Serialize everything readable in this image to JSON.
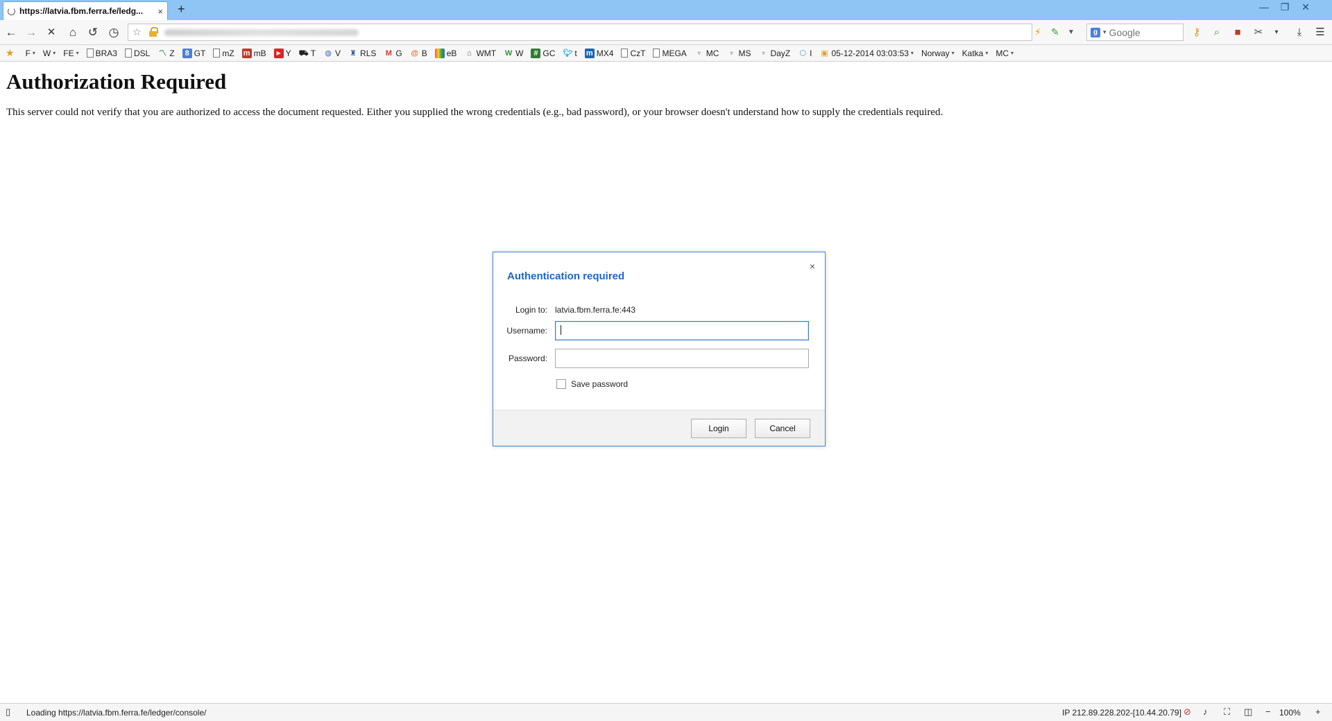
{
  "tab": {
    "title": "https://latvia.fbm.ferra.fe/ledg...",
    "close": "×",
    "new": "+"
  },
  "window": {
    "minimize": "—",
    "restore": "❐",
    "close": "✕"
  },
  "nav": {
    "back": "←",
    "forward": "→",
    "stop": "✕",
    "home": "⌂",
    "reload": "↺",
    "history": "◷"
  },
  "address": {
    "star": "☆"
  },
  "search": {
    "placeholder": "Google",
    "engine": "g"
  },
  "bookmarks": [
    {
      "label": "F",
      "dropdown": true
    },
    {
      "label": "W",
      "dropdown": true
    },
    {
      "label": "FE",
      "dropdown": true
    },
    {
      "label": "BRA3"
    },
    {
      "label": "DSL"
    },
    {
      "label": "Z"
    },
    {
      "label": "GT"
    },
    {
      "label": "mZ"
    },
    {
      "label": "mB"
    },
    {
      "label": "Y"
    },
    {
      "label": "T"
    },
    {
      "label": "V"
    },
    {
      "label": "RLS"
    },
    {
      "label": "G"
    },
    {
      "label": "B"
    },
    {
      "label": "eB"
    },
    {
      "label": "WMT"
    },
    {
      "label": "W"
    },
    {
      "label": "GC"
    },
    {
      "label": "t"
    },
    {
      "label": "MX4"
    },
    {
      "label": "CzT"
    },
    {
      "label": "MEGA"
    },
    {
      "label": "MC"
    },
    {
      "label": "MS"
    },
    {
      "label": "DayZ"
    },
    {
      "label": "I"
    },
    {
      "label": "05-12-2014 03:03:53",
      "dropdown": true
    },
    {
      "label": "Norway",
      "dropdown": true
    },
    {
      "label": "Katka",
      "dropdown": true
    },
    {
      "label": "MC",
      "dropdown": true
    }
  ],
  "page": {
    "heading": "Authorization Required",
    "body": "This server could not verify that you are authorized to access the document requested. Either you supplied the wrong credentials (e.g., bad password), or your browser doesn't understand how to supply the credentials required."
  },
  "dialog": {
    "title": "Authentication required",
    "close": "×",
    "login_to_label": "Login to:",
    "login_to_value": "latvia.fbm.ferra.fe:443",
    "username_label": "Username:",
    "username_value": "",
    "password_label": "Password:",
    "password_value": "",
    "save_password_label": "Save password",
    "login_button": "Login",
    "cancel_button": "Cancel"
  },
  "status": {
    "loading": "Loading https://latvia.fbm.ferra.fe/ledger/console/",
    "ip": "IP 212.89.228.202-[10.44.20.79]",
    "zoom": "100%",
    "zoom_out": "−",
    "zoom_in": "+"
  }
}
